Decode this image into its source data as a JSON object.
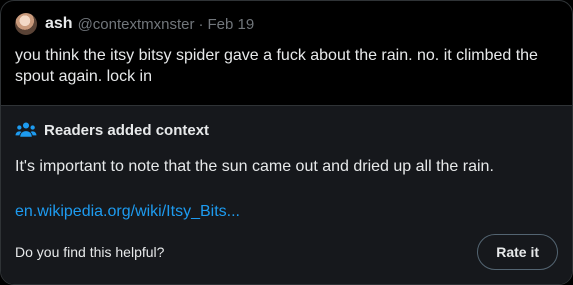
{
  "post": {
    "name": "ash",
    "handle": "@contextmxnster",
    "separator": "·",
    "date": "Feb 19",
    "text": "you think the itsy bitsy spider gave a fuck about the rain. no. it climbed the spout again. lock in"
  },
  "context": {
    "title": "Readers added context",
    "icon": "people-icon",
    "text": "It's important to note that the sun came out and dried up all the rain.",
    "link": "en.wikipedia.org/wiki/Itsy_Bits...",
    "helpful_prompt": "Do you find this helpful?",
    "rate_label": "Rate it"
  },
  "colors": {
    "background": "#000000",
    "context_bg": "#16181c",
    "link": "#1d9bf0",
    "muted": "#71767b",
    "border": "#2f3336"
  }
}
